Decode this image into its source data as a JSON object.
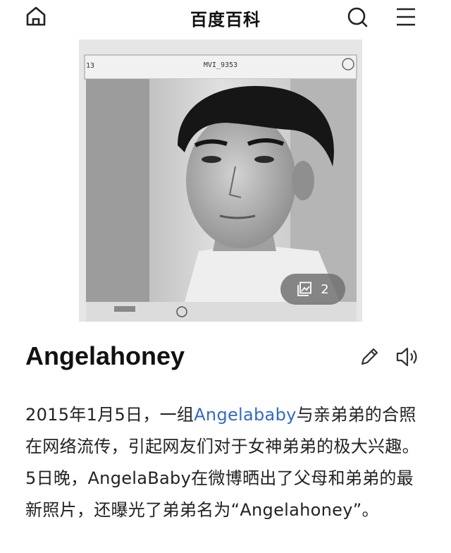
{
  "header": {
    "title": "百度百科",
    "icons": [
      "home-icon",
      "search-icon",
      "menu-icon"
    ]
  },
  "photo": {
    "screen_number": "13",
    "screen_title": "MVI_9353",
    "gallery_count": "2"
  },
  "entry": {
    "title": "Angelahoney"
  },
  "paragraph": {
    "text_1": "2015年1月5日，一组",
    "link": "Angelababy",
    "text_2": "与亲弟弟的合照在网络流传，引起网友们对于女神弟弟的极大兴趣。5日晚，AngelaBaby在微博晒出了父母和弟弟的最新照片，还曝光了弟弟名为“Angelahoney”。"
  },
  "colors": {
    "link": "#3469c6",
    "badge": "#6e6e6e"
  }
}
